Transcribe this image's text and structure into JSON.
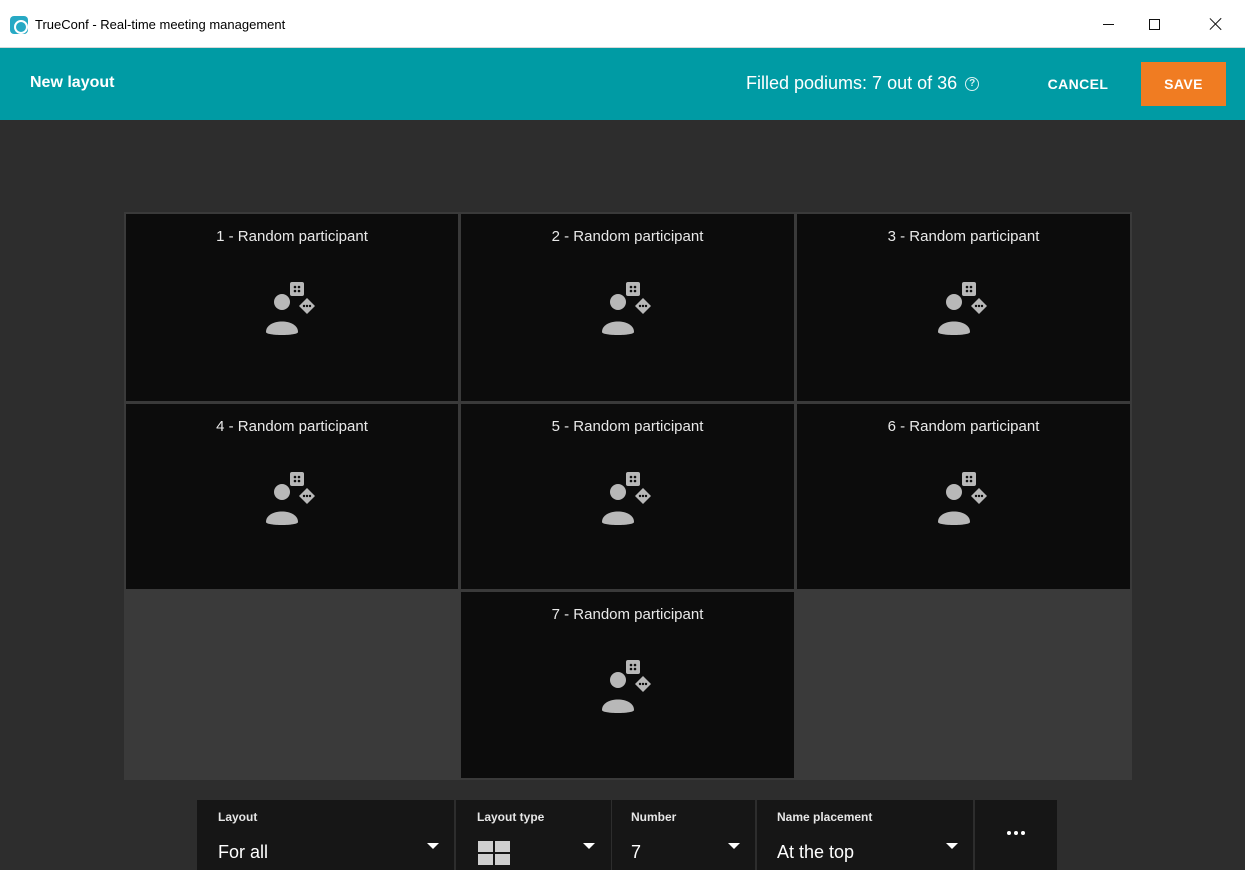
{
  "window": {
    "title": "TrueConf - Real-time meeting management",
    "icon": "trueconf-app-icon"
  },
  "header": {
    "title": "New layout",
    "filled_podiums": "Filled podiums: 7 out of 36",
    "cancel_label": "CANCEL",
    "save_label": "SAVE",
    "accent_color": "#009ba4",
    "save_color": "#f07c22"
  },
  "podiums": [
    {
      "label": "1 - Random participant",
      "icon": "random-participant-icon"
    },
    {
      "label": "2 - Random participant",
      "icon": "random-participant-icon"
    },
    {
      "label": "3 - Random participant",
      "icon": "random-participant-icon"
    },
    {
      "label": "4 - Random participant",
      "icon": "random-participant-icon"
    },
    {
      "label": "5 - Random participant",
      "icon": "random-participant-icon"
    },
    {
      "label": "6 - Random participant",
      "icon": "random-participant-icon"
    },
    {
      "label": "7 - Random participant",
      "icon": "random-participant-icon"
    }
  ],
  "toolbar": {
    "layout": {
      "label": "Layout",
      "value": "For all"
    },
    "layout_type": {
      "label": "Layout type",
      "icon": "grid-layout-icon"
    },
    "number": {
      "label": "Number",
      "value": "7"
    },
    "name_placement": {
      "label": "Name placement",
      "value": "At the top"
    },
    "more_icon": "more-icon"
  }
}
